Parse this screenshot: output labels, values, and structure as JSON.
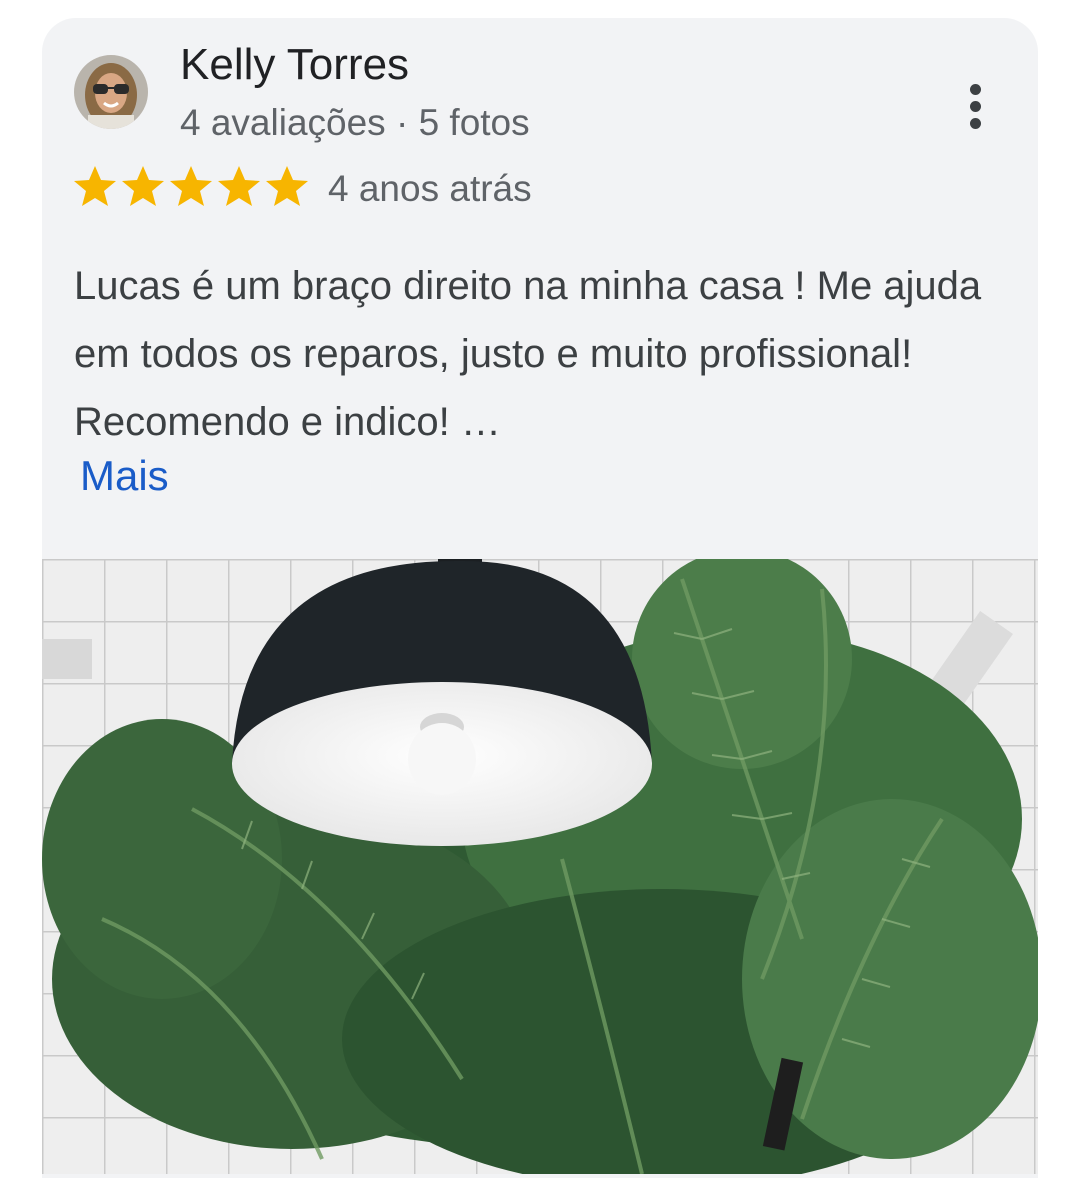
{
  "review": {
    "author_name": "Kelly Torres",
    "author_meta": "4 avaliações · 5 fotos",
    "rating": 5,
    "rating_max": 5,
    "time": "4 anos atrás",
    "text": "Lucas é um braço direito na minha casa ! Me ajuda em todos os reparos, justo e muito profissional! Recomendo e indico! …",
    "more_label": "Mais"
  },
  "icons": {
    "star": "star-icon",
    "menu": "more-vertical-icon"
  },
  "colors": {
    "star": "#f7b500",
    "link": "#1a5cc8",
    "card_bg": "#f2f3f5"
  }
}
